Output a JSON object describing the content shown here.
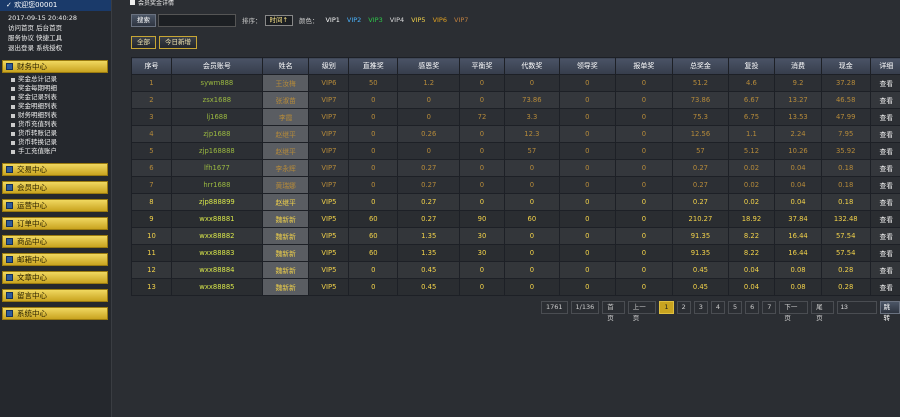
{
  "sidebar": {
    "welcome": "欢迎您00001",
    "userinfo": [
      "2017-09-15 20:40:28",
      "访问首页 后台首页",
      "服务协议 快捷工具",
      "退出登录 系统授权"
    ],
    "finance": {
      "label": "财务中心",
      "items": [
        "奖金总计记录",
        "奖金每期明细",
        "奖金记录列表",
        "奖金明细列表",
        "财务明细列表",
        "货币充值列表",
        "货币转账记录",
        "货币转换记录",
        "手工充值账户"
      ]
    },
    "sections": [
      "交易中心",
      "会员中心",
      "运营中心",
      "订单中心",
      "商品中心",
      "邮箱中心",
      "文章中心",
      "留言中心",
      "系统中心"
    ]
  },
  "main": {
    "title": "会员奖金详情",
    "toolbar": {
      "search_btn": "搜索",
      "search_placeholder": "",
      "sort_label": "排序：",
      "sort_value": "时间↑",
      "color_label": "颜色：",
      "vips": [
        {
          "label": "VIP1",
          "color": "#ffffff"
        },
        {
          "label": "VIP2",
          "color": "#4ab4ff"
        },
        {
          "label": "VIP3",
          "color": "#2ec84a"
        },
        {
          "label": "VIP4",
          "color": "#dddddd"
        },
        {
          "label": "VIP5",
          "color": "#f2d24a"
        },
        {
          "label": "VIP6",
          "color": "#e0a020"
        },
        {
          "label": "VIP7",
          "color": "#c08040"
        }
      ]
    },
    "filters": {
      "all": "全部",
      "today": "今日新增"
    },
    "columns": [
      "序号",
      "会员账号",
      "姓名",
      "级别",
      "直推奖",
      "感恩奖",
      "平衡奖",
      "代数奖",
      "领导奖",
      "报单奖",
      "总奖金",
      "复投",
      "消费",
      "现金",
      "详细"
    ],
    "rows": [
      {
        "cls": "dim",
        "cells": [
          "1",
          "sywm888",
          "王汝梅",
          "VIP6",
          "50",
          "1.2",
          "0",
          "0",
          "0",
          "0",
          "51.2",
          "4.6",
          "9.2",
          "37.28"
        ]
      },
      {
        "cls": "dim",
        "cells": [
          "2",
          "zsx1688",
          "张淑苗",
          "VIP7",
          "0",
          "0",
          "0",
          "73.86",
          "0",
          "0",
          "73.86",
          "6.67",
          "13.27",
          "46.58"
        ]
      },
      {
        "cls": "dim",
        "cells": [
          "3",
          "lj1688",
          "李霞",
          "VIP7",
          "0",
          "0",
          "72",
          "3.3",
          "0",
          "0",
          "75.3",
          "6.75",
          "13.53",
          "47.99"
        ]
      },
      {
        "cls": "dim",
        "cells": [
          "4",
          "zjp1688",
          "赵继平",
          "VIP7",
          "0",
          "0.26",
          "0",
          "12.3",
          "0",
          "0",
          "12.56",
          "1.1",
          "2.24",
          "7.95"
        ]
      },
      {
        "cls": "dim",
        "cells": [
          "5",
          "zjp168888",
          "赵继平",
          "VIP7",
          "0",
          "0",
          "0",
          "57",
          "0",
          "0",
          "57",
          "5.12",
          "10.26",
          "35.92"
        ]
      },
      {
        "cls": "dim",
        "cells": [
          "6",
          "lfh1677",
          "李永辉",
          "VIP7",
          "0",
          "0.27",
          "0",
          "0",
          "0",
          "0",
          "0.27",
          "0.02",
          "0.04",
          "0.18"
        ]
      },
      {
        "cls": "dim",
        "cells": [
          "7",
          "hrr1688",
          "黄瑞娜",
          "VIP7",
          "0",
          "0.27",
          "0",
          "0",
          "0",
          "0",
          "0.27",
          "0.02",
          "0.04",
          "0.18"
        ]
      },
      {
        "cls": "bright",
        "cells": [
          "8",
          "zjp888899",
          "赵继平",
          "VIP5",
          "0",
          "0.27",
          "0",
          "0",
          "0",
          "0",
          "0.27",
          "0.02",
          "0.04",
          "0.18"
        ]
      },
      {
        "cls": "bright",
        "cells": [
          "9",
          "wxx88881",
          "魏新新",
          "VIP5",
          "60",
          "0.27",
          "90",
          "60",
          "0",
          "0",
          "210.27",
          "18.92",
          "37.84",
          "132.48"
        ]
      },
      {
        "cls": "bright",
        "cells": [
          "10",
          "wxx88882",
          "魏新新",
          "VIP5",
          "60",
          "1.35",
          "30",
          "0",
          "0",
          "0",
          "91.35",
          "8.22",
          "16.44",
          "57.54"
        ]
      },
      {
        "cls": "bright",
        "cells": [
          "11",
          "wxx88883",
          "魏新新",
          "VIP5",
          "60",
          "1.35",
          "30",
          "0",
          "0",
          "0",
          "91.35",
          "8.22",
          "16.44",
          "57.54"
        ]
      },
      {
        "cls": "bright",
        "cells": [
          "12",
          "wxx88884",
          "魏新新",
          "VIP5",
          "0",
          "0.45",
          "0",
          "0",
          "0",
          "0",
          "0.45",
          "0.04",
          "0.08",
          "0.28"
        ]
      },
      {
        "cls": "bright",
        "cells": [
          "13",
          "wxx88885",
          "魏新新",
          "VIP5",
          "0",
          "0.45",
          "0",
          "0",
          "0",
          "0",
          "0.45",
          "0.04",
          "0.08",
          "0.28"
        ]
      }
    ],
    "detail_label": "查看",
    "pager": {
      "total": "1761",
      "pages": "1/136",
      "first": "首页",
      "prev": "上一页",
      "numbers": [
        "1",
        "2",
        "3",
        "4",
        "5",
        "6",
        "7"
      ],
      "current": "1",
      "next": "下一页",
      "last": "尾页",
      "input_value": "13",
      "go": "跳转"
    }
  }
}
